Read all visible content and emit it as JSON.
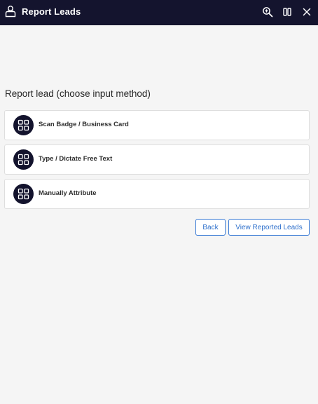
{
  "window": {
    "title": "Report Leads",
    "icons": {
      "app": "lock-person-icon",
      "zoom": "zoom-in-icon",
      "split": "split-view-icon",
      "close": "close-icon"
    },
    "colors": {
      "titlebar_bg": "#14142e",
      "title_text": "#ffffff"
    }
  },
  "main": {
    "heading": "Report lead (choose input method)",
    "options": [
      {
        "label": "Scan Badge / Business Card",
        "icon": "grid-icon"
      },
      {
        "label": "Type / Dictate Free Text",
        "icon": "grid-icon"
      },
      {
        "label": "Manually Attribute",
        "icon": "grid-icon"
      }
    ],
    "actions": {
      "back_label": "Back",
      "view_label": "View Reported Leads"
    },
    "colors": {
      "accent": "#2d6fcb",
      "icon_bg": "#13132d",
      "page_bg": "#f5f5f5"
    }
  }
}
